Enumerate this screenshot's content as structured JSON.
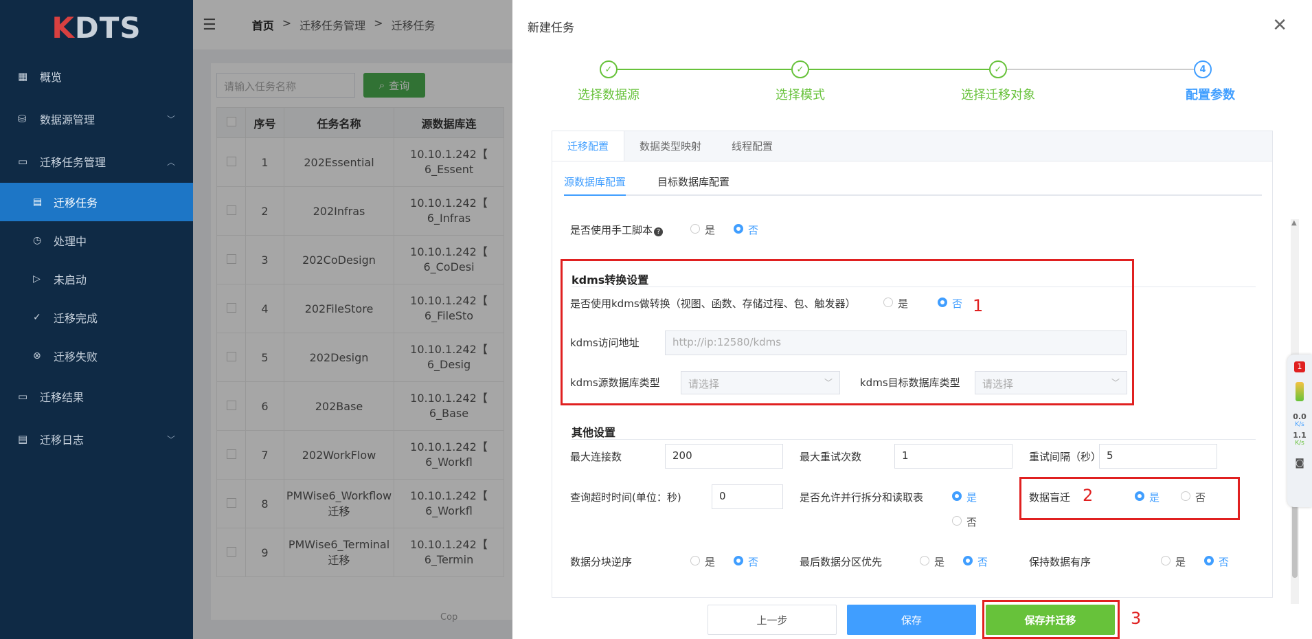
{
  "sidebar": {
    "logo": {
      "k": "K",
      "rest": "DTS"
    },
    "items": [
      {
        "label": "概览"
      },
      {
        "label": "数据源管理"
      },
      {
        "label": "迁移任务管理"
      },
      {
        "label": "迁移结果"
      },
      {
        "label": "迁移日志"
      }
    ],
    "subitems": [
      {
        "label": "迁移任务"
      },
      {
        "label": "处理中"
      },
      {
        "label": "未启动"
      },
      {
        "label": "迁移完成"
      },
      {
        "label": "迁移失败"
      }
    ]
  },
  "breadcrumb": {
    "home": "首页",
    "sep": ">",
    "l2": "迁移任务管理",
    "l3": "迁移任务"
  },
  "list": {
    "search_placeholder": "请输入任务名称",
    "query_label": "查询",
    "columns": {
      "seq": "序号",
      "name": "任务名称",
      "source": "源数据库连"
    },
    "rows": [
      {
        "seq": "1",
        "name": "202Essential",
        "src1": "10.10.1.242【",
        "src2": "6_Essent"
      },
      {
        "seq": "2",
        "name": "202Infras",
        "src1": "10.10.1.242【",
        "src2": "6_Infras"
      },
      {
        "seq": "3",
        "name": "202CoDesign",
        "src1": "10.10.1.242【",
        "src2": "6_CoDesi"
      },
      {
        "seq": "4",
        "name": "202FileStore",
        "src1": "10.10.1.242【",
        "src2": "6_FileSto"
      },
      {
        "seq": "5",
        "name": "202Design",
        "src1": "10.10.1.242【",
        "src2": "6_Desig"
      },
      {
        "seq": "6",
        "name": "202Base",
        "src1": "10.10.1.242【",
        "src2": "6_Base"
      },
      {
        "seq": "7",
        "name": "202WorkFlow",
        "src1": "10.10.1.242【",
        "src2": "6_Workfl"
      },
      {
        "seq": "8",
        "name": "PMWise6_Workflow迁移",
        "src1": "10.10.1.242【",
        "src2": "6_Workfl"
      },
      {
        "seq": "9",
        "name": "PMWise6_Terminal迁移",
        "src1": "10.10.1.242【",
        "src2": "6_Termin"
      }
    ],
    "footer_text": "Cop"
  },
  "drawer": {
    "title": "新建任务",
    "steps": [
      {
        "label": "选择数据源"
      },
      {
        "label": "选择模式"
      },
      {
        "label": "选择迁移对象"
      },
      {
        "label": "配置参数",
        "num": "4"
      }
    ],
    "tabs": [
      "迁移配置",
      "数据类型映射",
      "线程配置"
    ],
    "subtabs": [
      "源数据库配置",
      "目标数据库配置"
    ],
    "manual_script": {
      "label": "是否使用手工脚本",
      "yes": "是",
      "no": "否",
      "value": "否"
    },
    "kdms": {
      "section": "kdms转换设置",
      "use_label": "是否使用kdms做转换（视图、函数、存储过程、包、触发器）",
      "yes": "是",
      "no": "否",
      "value": "否",
      "url_label": "kdms访问地址",
      "url_placeholder": "http://ip:12580/kdms",
      "src_type_label": "kdms源数据库类型",
      "tgt_type_label": "kdms目标数据库类型",
      "select_placeholder": "请选择"
    },
    "other": {
      "section": "其他设置",
      "max_conn_label": "最大连接数",
      "max_conn": "200",
      "max_retry_label": "最大重试次数",
      "max_retry": "1",
      "retry_interval_label": "重试间隔（秒）",
      "retry_interval": "5",
      "query_timeout_label": "查询超时时间(单位：秒)",
      "query_timeout": "0",
      "parallel_label": "是否允许并行拆分和读取表",
      "parallel": "是",
      "blind_label": "数据盲迁",
      "blind": "是",
      "reverse_label": "数据分块逆序",
      "reverse": "否",
      "last_part_label": "最后数据分区优先",
      "last_part": "否",
      "keep_order_label": "保持数据有序",
      "keep_order": "否",
      "yes": "是",
      "no": "否"
    },
    "annotations": [
      "1",
      "2",
      "3"
    ],
    "buttons": {
      "prev": "上一步",
      "save": "保存",
      "save_migrate": "保存并迁移"
    }
  },
  "float_tool": {
    "badge": "1",
    "up": "0.0",
    "down": "1.1",
    "unit": "K/s"
  },
  "colors": {
    "primary": "#409eff",
    "success": "#67c23a",
    "sidebar": "#0f2a45",
    "active": "#1d76c6",
    "annotation": "#e02020"
  }
}
